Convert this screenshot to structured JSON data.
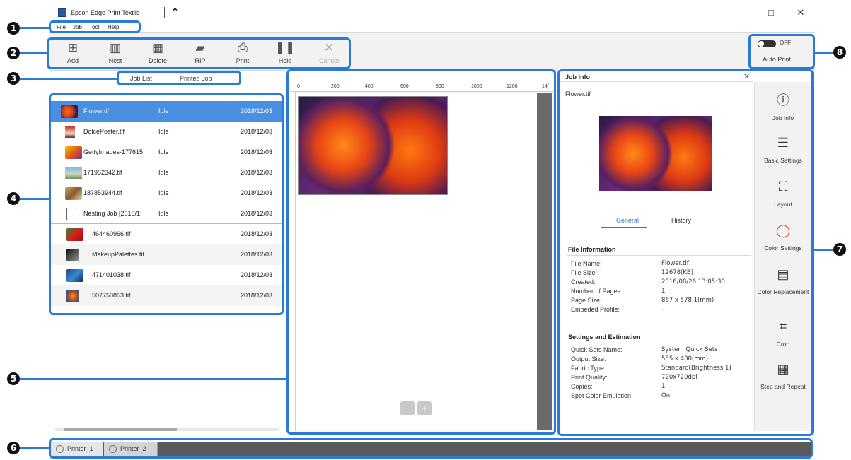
{
  "titlebar": {
    "app_title": "Epson Edge Print Textile",
    "caret": "⌃",
    "minimize": "–",
    "maximize": "□",
    "close": "✕"
  },
  "menu": {
    "items": [
      "File",
      "Job",
      "Tool",
      "Help"
    ]
  },
  "toolbar": {
    "add": "Add",
    "nest": "Nest",
    "delete": "Delete",
    "rip": "RIP",
    "print": "Print",
    "hold": "Hold",
    "cancel": "Cancel",
    "auto_print_label": "Auto Print",
    "auto_print_state": "OFF"
  },
  "tabs": {
    "job_list": "Job List",
    "printed_job": "Printed Job"
  },
  "job_list": {
    "rows": [
      {
        "name": "Flower.tif",
        "status": "Idle",
        "date": "2018/12/03"
      },
      {
        "name": "DolcePoster.tif",
        "status": "Idle",
        "date": "2018/12/03"
      },
      {
        "name": "GettyImages-177615",
        "status": "Idle",
        "date": "2018/12/03"
      },
      {
        "name": "171952342.tif",
        "status": "Idle",
        "date": "2018/12/03"
      },
      {
        "name": "187853944.tif",
        "status": "Idle",
        "date": "2018/12/03"
      },
      {
        "name": "Nesting Job [2018/1:",
        "status": "Idle",
        "date": "2018/12/03"
      },
      {
        "name": "464460966.tif",
        "status": "",
        "date": "2018/12/03"
      },
      {
        "name": "MakeupPalettes.tif",
        "status": "",
        "date": "2018/12/03"
      },
      {
        "name": "471401038.tif",
        "status": "",
        "date": "2018/12/03"
      },
      {
        "name": "507750853.tif",
        "status": "",
        "date": "2018/12/03"
      }
    ]
  },
  "preview": {
    "ruler_labels": [
      "0",
      "200",
      "400",
      "600",
      "800",
      "1000",
      "1200",
      "14("
    ],
    "zoom_out": "−",
    "zoom_in": "+"
  },
  "job_info": {
    "title": "Job Info",
    "file_name": "Flower.tif",
    "tabs": [
      "General",
      "History"
    ],
    "file_information_title": "File Information",
    "file_information": [
      {
        "key": "File Name:",
        "value": "Flower.tif"
      },
      {
        "key": "File Size:",
        "value": "12678(KB)"
      },
      {
        "key": "Created:",
        "value": "2016/08/26 13:05:30"
      },
      {
        "key": "Number of Pages:",
        "value": "1"
      },
      {
        "key": "Page Size:",
        "value": "867 x 578.1(mm)"
      },
      {
        "key": "Embeded Profile:",
        "value": "-"
      }
    ],
    "settings_title": "Settings and Estimation",
    "settings": [
      {
        "key": "Quick Sets Name:",
        "value": "System Quick Sets"
      },
      {
        "key": "Output Size:",
        "value": "555 x 400(mm)"
      },
      {
        "key": "Fabric Type:",
        "value": "Standard[Brightness 1]"
      },
      {
        "key": "Print Quality:",
        "value": "720x720dpi"
      },
      {
        "key": "Copies:",
        "value": "1"
      },
      {
        "key": "Spot Color Emulation:",
        "value": "On"
      }
    ],
    "side_menu": [
      {
        "label": "Job Info",
        "icon": "ⓘ"
      },
      {
        "label": "Basic Settings",
        "icon": "☰"
      },
      {
        "label": "Layout",
        "icon": "⛶"
      },
      {
        "label": "Color Settings",
        "icon": "◯"
      },
      {
        "label": "Color Replacement",
        "icon": "▤"
      },
      {
        "label": "Crop",
        "icon": "⌗"
      },
      {
        "label": "Step and Repeat",
        "icon": "▦"
      }
    ]
  },
  "printers": [
    "Printer_1",
    "Printer_2"
  ],
  "callouts": [
    "1",
    "2",
    "3",
    "4",
    "5",
    "6",
    "7",
    "8"
  ],
  "colors": {
    "accent": "#2a7bd5",
    "selected_row": "#4a90e2",
    "marker": "#111111"
  }
}
